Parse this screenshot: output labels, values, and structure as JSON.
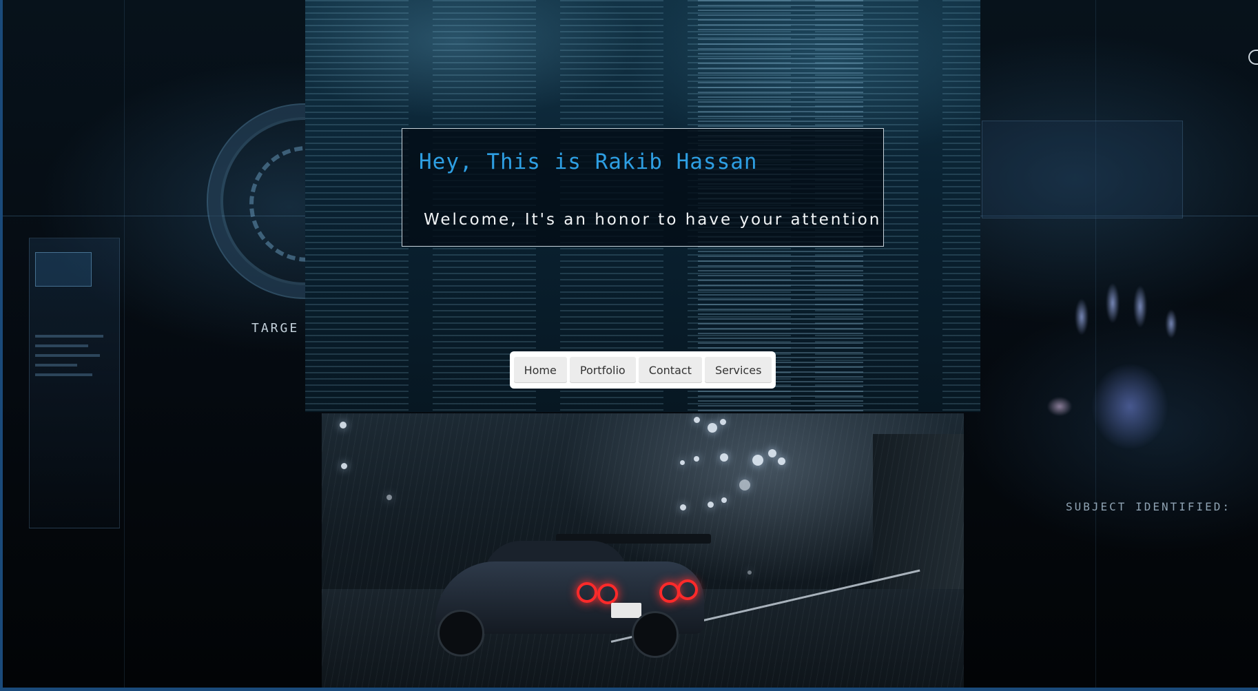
{
  "hero": {
    "title": "Hey, This is Rakib Hassan",
    "subtitle": "Welcome, It's an honor to have your attention"
  },
  "nav": {
    "items": [
      {
        "label": "Home"
      },
      {
        "label": "Portfolio"
      },
      {
        "label": "Contact"
      },
      {
        "label": "Services"
      }
    ]
  },
  "background": {
    "left_label": "TARGE",
    "right_label": "SUBJECT IDENTIFIED:"
  },
  "colors": {
    "title": "#2e9fe3",
    "subtitle": "#f1f4f6",
    "page_border": "#1a4a7a",
    "taillight": "#ff2a2a"
  },
  "icons": {
    "side": "partial-circle-icon"
  }
}
